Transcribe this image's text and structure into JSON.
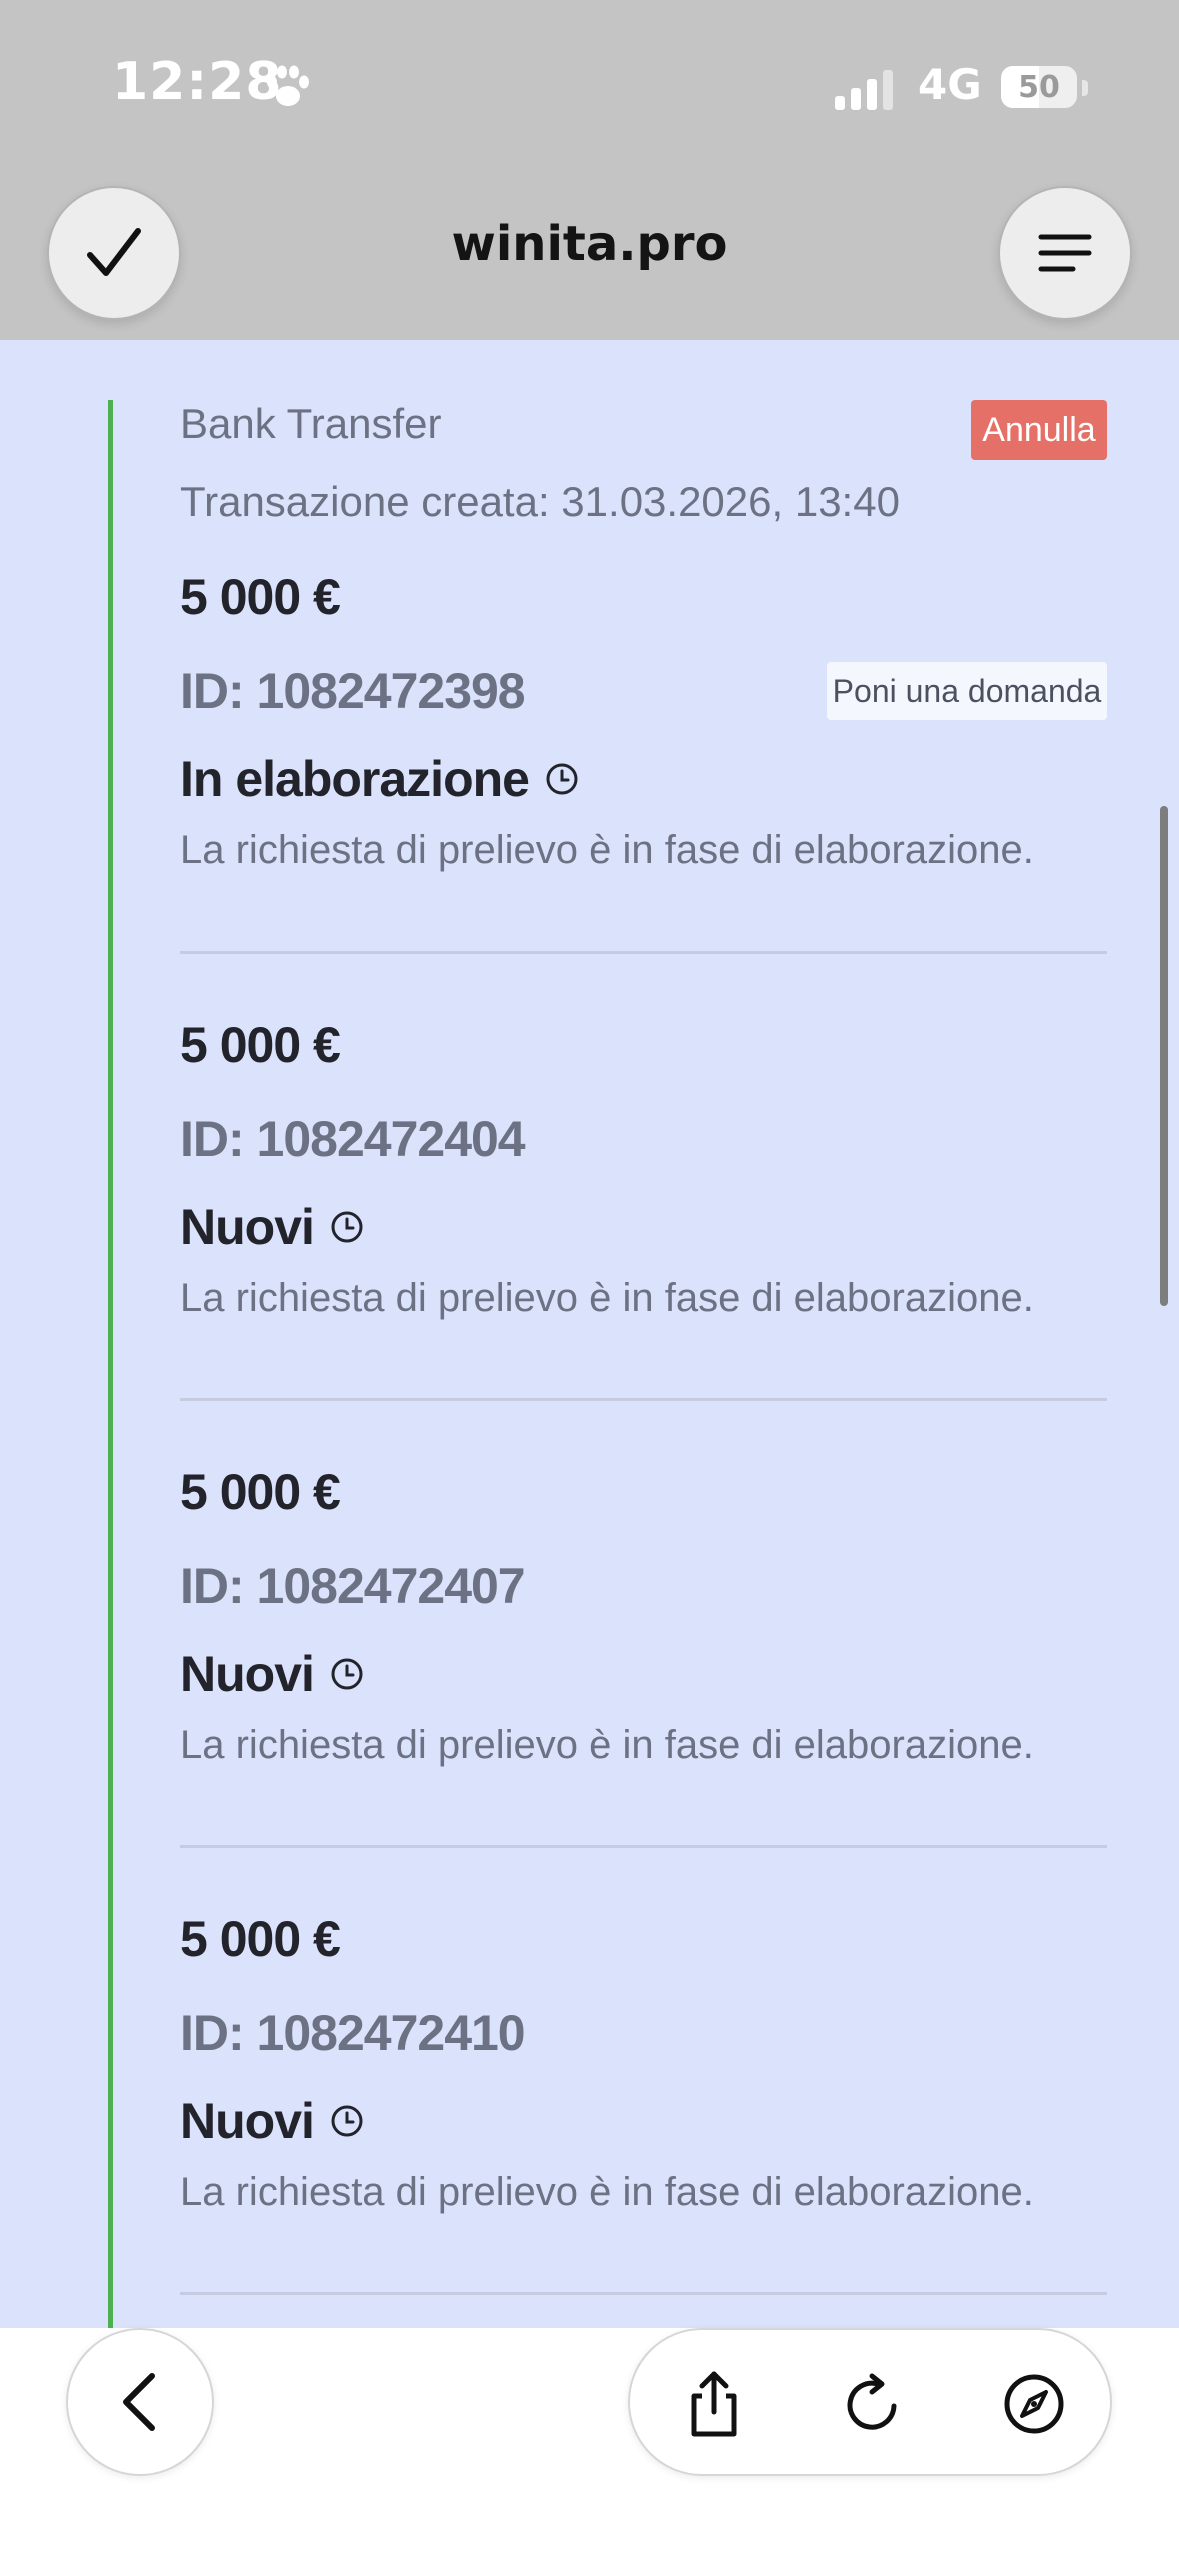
{
  "status_bar": {
    "time": "12:28",
    "network": "4G",
    "battery": "50",
    "battery_level": 0.5
  },
  "browser": {
    "url": "winita.pro"
  },
  "first_entry": {
    "method": "Bank Transfer",
    "cancel_label": "Annulla",
    "created": "Transazione creata: 31.03.2026, 13:40",
    "ask_label": "Poni una domanda"
  },
  "transactions": [
    {
      "amount": "5 000 €",
      "id": "ID: 1082472398",
      "status": "In elaborazione",
      "description": "La richiesta di prelievo è in fase di elaborazione."
    },
    {
      "amount": "5 000 €",
      "id": "ID: 1082472404",
      "status": "Nuovi",
      "description": "La richiesta di prelievo è in fase di elaborazione."
    },
    {
      "amount": "5 000 €",
      "id": "ID: 1082472407",
      "status": "Nuovi",
      "description": "La richiesta di prelievo è in fase di elaborazione."
    },
    {
      "amount": "5 000 €",
      "id": "ID: 1082472410",
      "status": "Nuovi",
      "description": "La richiesta di prelievo è in fase di elaborazione."
    }
  ],
  "icons": {
    "paw": "paw-icon",
    "signal": "signal-icon",
    "check": "checkmark-icon",
    "menu": "menu-icon",
    "clock": "clock-icon",
    "back": "chevron-left-icon",
    "share": "share-icon",
    "reload": "reload-icon",
    "compass": "compass-icon"
  },
  "colors": {
    "background": "#dbe2fb",
    "chrome": "#c4c4c4",
    "timeline": "#4caf50",
    "cancel": "#e57067"
  }
}
